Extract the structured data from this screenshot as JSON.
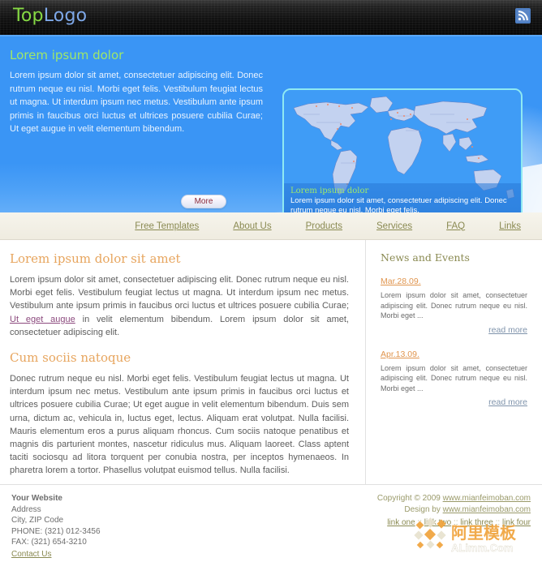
{
  "header": {
    "logo_top": "Top",
    "logo_bottom": "Logo",
    "rss_icon": "rss-feed-icon"
  },
  "hero": {
    "heading": "Lorem ipsum dolor",
    "paragraph": "Lorem ipsum dolor sit amet, consectetuer adipiscing elit. Donec rutrum neque eu nisl. Morbi eget felis. Vestibulum feugiat lectus ut magna. Ut interdum ipsum nec metus. Vestibulum ante ipsum primis in faucibus orci luctus et ultrices posuere cubilia Curae; Ut eget augue in velit elementum bibendum.",
    "more_label": "More",
    "map_caption_heading": "Lorem ipsum dolor",
    "map_caption_text": "Lorem ipsum dolor sit amet, consectetuer adipiscing elit. Donec rutrum neque eu nisl. Morbi eget felis.",
    "map_icon": "world-map-image"
  },
  "nav": {
    "items": [
      {
        "label": "Free Templates"
      },
      {
        "label": "About Us"
      },
      {
        "label": "Products"
      },
      {
        "label": "Services"
      },
      {
        "label": "FAQ"
      },
      {
        "label": "Links"
      }
    ]
  },
  "main": {
    "section1_heading": "Lorem ipsum dolor sit amet",
    "section1_text_a": "Lorem ipsum dolor sit amet, consectetuer adipiscing elit. Donec rutrum neque eu nisl. Morbi eget felis. Vestibulum feugiat lectus ut magna. Ut interdum ipsum nec metus. Vestibulum ante ipsum primis in faucibus orci luctus et ultrices posuere cubilia Curae; ",
    "section1_link": "Ut eget augue",
    "section1_text_b": " in velit elementum bibendum. Lorem ipsum dolor sit amet, consectetuer adipiscing elit.",
    "section2_heading": "Cum sociis natoque",
    "section2_text": "Donec rutrum neque eu nisl. Morbi eget felis. Vestibulum feugiat lectus ut magna. Ut interdum ipsum nec metus. Vestibulum ante ipsum primis in faucibus orci luctus et ultrices posuere cubilia Curae; Ut eget augue in velit elementum bibendum. Duis sem urna, dictum ac, vehicula in, luctus eget, lectus. Aliquam erat volutpat. Nulla facilisi. Mauris elementum eros a purus aliquam rhoncus. Cum sociis natoque penatibus et magnis dis parturient montes, nascetur ridiculus mus. Aliquam laoreet. Class aptent taciti sociosqu ad litora torquent per conubia nostra, per inceptos hymenaeos. In pharetra lorem a tortor. Phasellus volutpat euismod tellus. Nulla facilisi."
  },
  "sidebar": {
    "heading": "News and Events",
    "items": [
      {
        "date": "Mar.28.09.",
        "text": "Lorem ipsum dolor sit amet, consectetuer adipiscing elit. Donec rutrum neque eu nisl. Morbi eget ...",
        "read_more": "read more"
      },
      {
        "date": "Apr.13.09.",
        "text": "Lorem ipsum dolor sit amet, consectetuer adipiscing elit. Donec rutrum neque eu nisl. Morbi eget ...",
        "read_more": "read more"
      }
    ]
  },
  "footer": {
    "company": "Your Website",
    "address": "Address",
    "city_zip": "City, ZIP Code",
    "phone": "PHONE: (321) 012-3456",
    "fax": "FAX: (321) 654-3210",
    "contact": "Contact Us",
    "copyright_prefix": "Copyright © 2009 ",
    "copyright_link": "www.mianfeimoban.com",
    "design_prefix": "Design by ",
    "design_link": "www.mianfeimoban.com",
    "links": [
      {
        "label": "link one"
      },
      {
        "label": "link two"
      },
      {
        "label": "link three"
      },
      {
        "label": "link four"
      }
    ],
    "link_separator": " :: ",
    "watermark_cn": "阿里模板",
    "watermark_en": "ALimm.Com"
  },
  "colors": {
    "hero_blue": "#3a95f5",
    "logo_green": "#86d944",
    "logo_blue": "#7ea8e8",
    "heading_orange": "#e7a55e",
    "nav_olive": "#8a8a52",
    "nav_bg": "#f2efe4",
    "date_orange": "#e0954e",
    "readmore_blue": "#7f93ab",
    "map_border_cyan": "#8fe9f2",
    "watermark_orange": "#f0a33c"
  }
}
